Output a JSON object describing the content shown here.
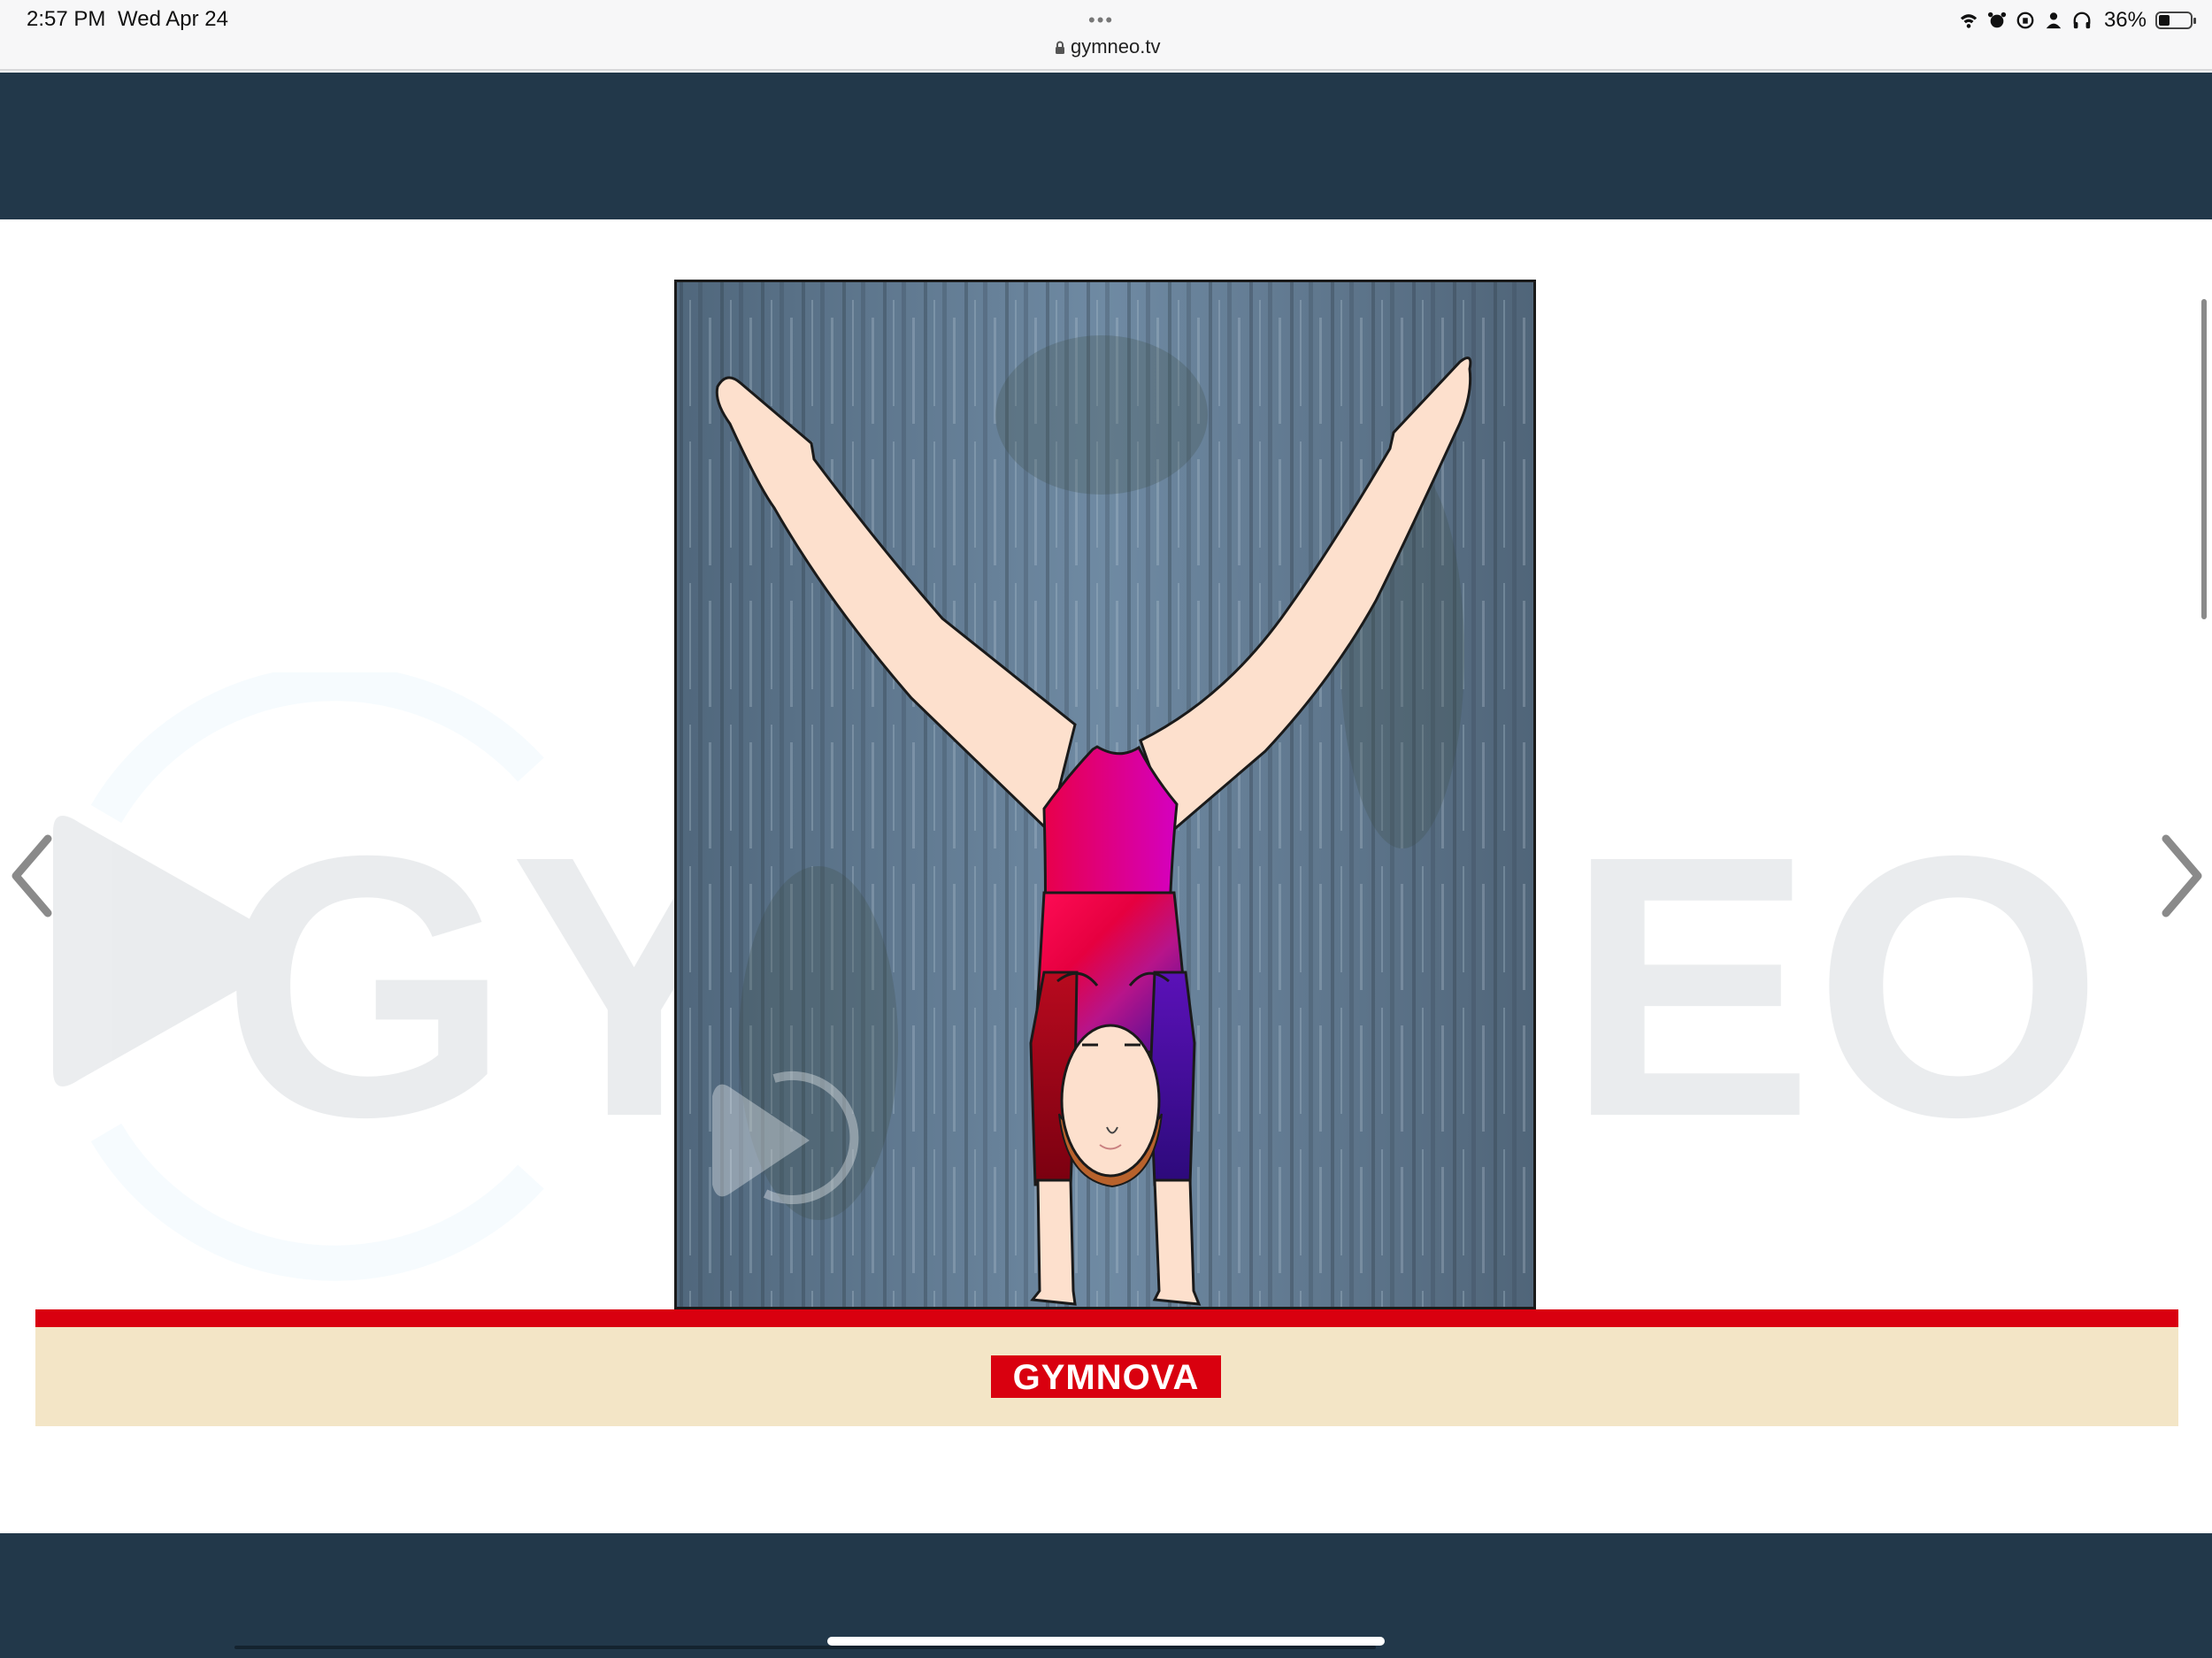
{
  "status_bar": {
    "time": "2:57 PM",
    "date": "Wed Apr 24",
    "url": "gymneo.tv",
    "battery_percent": "36%",
    "battery_level": 0.36
  },
  "watermark": {
    "left_text": "GY",
    "right_text": "EO"
  },
  "beam": {
    "brand": "GYMNOVA",
    "brand_color": "#d9000f"
  },
  "colors": {
    "band": "#22384a",
    "beam_red": "#d9000f",
    "beam_body": "#f3e5c6"
  },
  "icons": {
    "prev": "chevron-left-icon",
    "next": "chevron-right-icon",
    "lock": "lock-icon"
  }
}
